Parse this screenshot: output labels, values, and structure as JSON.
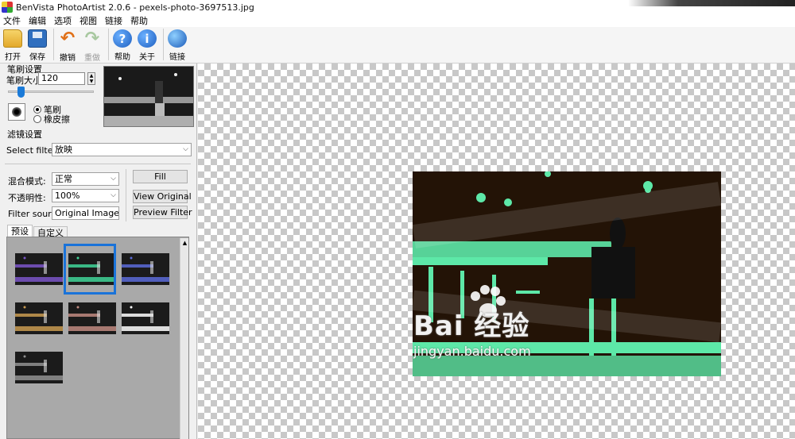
{
  "window": {
    "title": "BenVista PhotoArtist 2.0.6 - pexels-photo-3697513.jpg"
  },
  "menu": [
    "文件",
    "编辑",
    "选项",
    "视图",
    "链接",
    "帮助"
  ],
  "toolbar": {
    "open": "打开",
    "save": "保存",
    "undo": "撤销",
    "redo": "重做",
    "help": "帮助",
    "about": "关于",
    "link": "链接",
    "help_glyph": "?",
    "about_glyph": "i",
    "undo_glyph": "↶",
    "redo_glyph": "↷"
  },
  "brush": {
    "group_title": "笔刷设置",
    "size_label": "笔刷大小:",
    "size_value": "120",
    "size_level": 0.15,
    "mode_brush": "笔刷",
    "mode_eraser": "橡皮擦",
    "selected_mode": "brush"
  },
  "filter": {
    "group_title": "滤镜设置",
    "select_label": "Select filter:",
    "select_value": "放映",
    "blend_label": "混合模式:",
    "blend_value": "正常",
    "opacity_label": "不透明性:",
    "opacity_value": "100%",
    "source_label": "Filter source:",
    "source_value": "Original Image",
    "fill_button": "Fill",
    "view_original_button": "View Original",
    "preview_button": "Preview Filter"
  },
  "tabs": [
    "预设",
    "自定义"
  ],
  "presets": {
    "tints": [
      "#7a55c8",
      "#40d498",
      "#5a6ad8",
      "#c89a50",
      "#c08a80",
      "#ffffff",
      "#909090"
    ],
    "selected_index": 1
  },
  "watermark": {
    "main": "Bai 经验",
    "sub": "jingyan.baidu.com"
  },
  "colors": {
    "accent": "#1a73d9",
    "filter_tint": "#5de8a8",
    "photo_base": "#231306"
  }
}
